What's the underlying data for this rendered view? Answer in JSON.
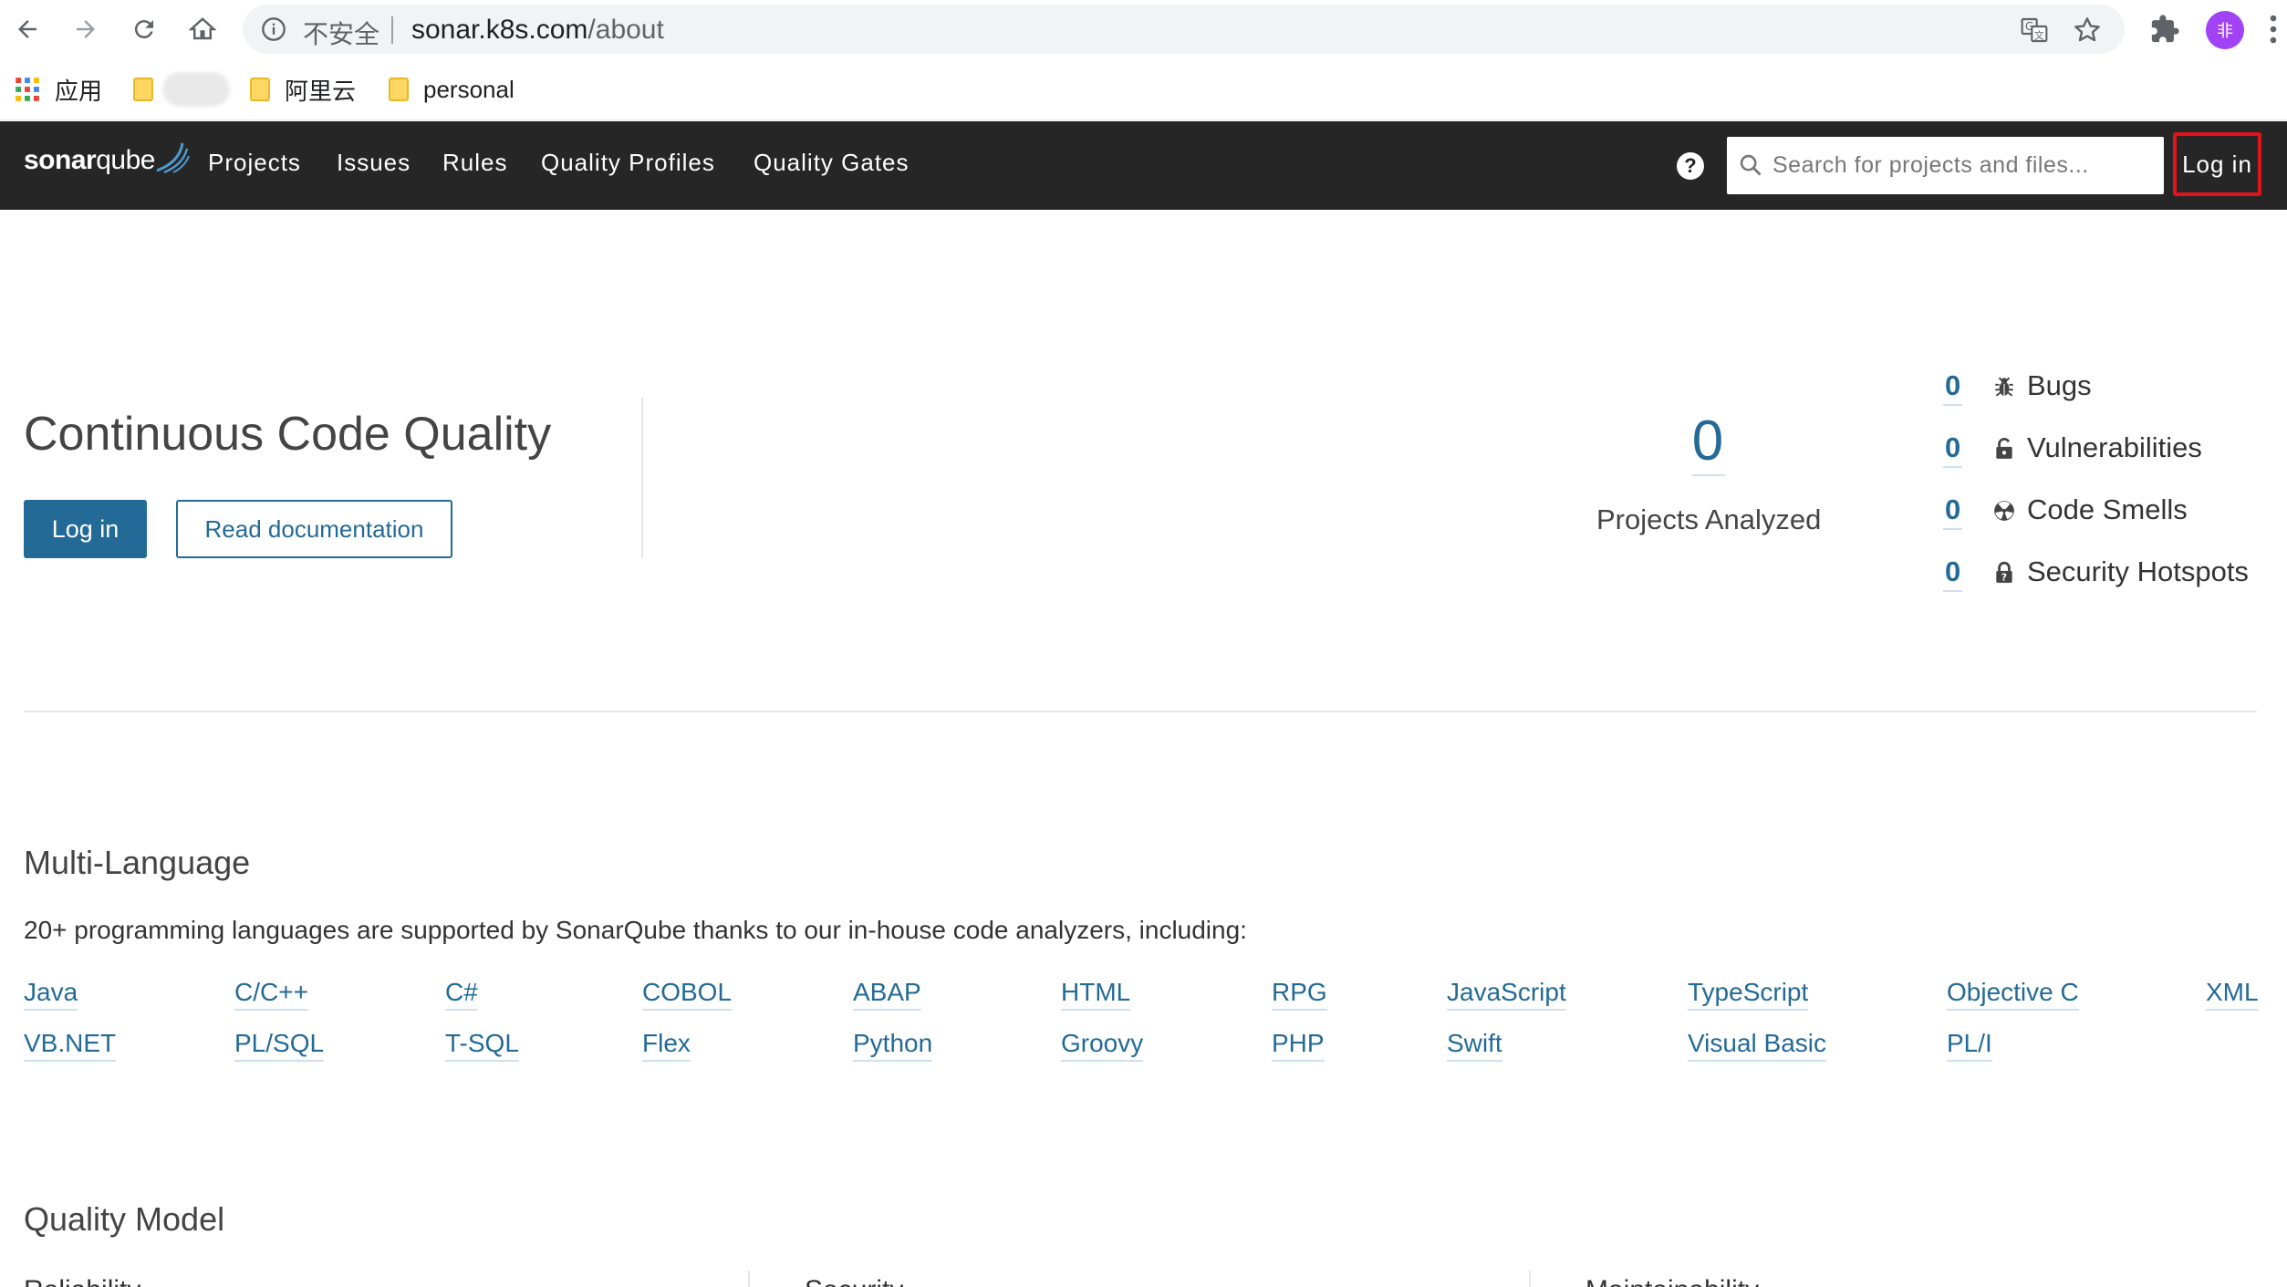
{
  "browser": {
    "insecure_label": "不安全",
    "url_host": "sonar.k8s.com",
    "url_path": "/about",
    "profile_initial": "非",
    "bookmarks": [
      {
        "label": "应用",
        "icon": "apps-grid-icon"
      },
      {
        "label": "",
        "icon": "folder-icon"
      },
      {
        "label": "阿里云",
        "icon": "folder-icon"
      },
      {
        "label": "personal",
        "icon": "folder-icon"
      }
    ]
  },
  "sonar_nav": {
    "logo_regular": "sonar",
    "logo_bold": "qube",
    "menu": [
      "Projects",
      "Issues",
      "Rules",
      "Quality Profiles",
      "Quality Gates"
    ],
    "search_placeholder": "Search for projects and files...",
    "login_label": "Log in",
    "colors": {
      "navbar": "#262626",
      "highlight_border": "#e0141a"
    }
  },
  "hero": {
    "title": "Continuous Code Quality",
    "login_button": "Log in",
    "docs_button": "Read documentation",
    "projects_count": "0",
    "projects_label": "Projects Analyzed",
    "metrics": [
      {
        "value": "0",
        "label": "Bugs",
        "icon": "bug-icon"
      },
      {
        "value": "0",
        "label": "Vulnerabilities",
        "icon": "lock-icon"
      },
      {
        "value": "0",
        "label": "Code Smells",
        "icon": "code-smell-icon"
      },
      {
        "value": "0",
        "label": "Security Hotspots",
        "icon": "security-hotspot-icon"
      }
    ],
    "accent": "#236a97"
  },
  "multi_language": {
    "title": "Multi-Language",
    "description": "20+ programming languages are supported by SonarQube thanks to our in-house code analyzers, including:",
    "row1": [
      "Java",
      "C/C++",
      "C#",
      "COBOL",
      "ABAP",
      "HTML",
      "RPG",
      "JavaScript",
      "TypeScript",
      "Objective C",
      "XML"
    ],
    "row2": [
      "VB.NET",
      "PL/SQL",
      "T-SQL",
      "Flex",
      "Python",
      "Groovy",
      "PHP",
      "Swift",
      "Visual Basic",
      "PL/I"
    ]
  },
  "quality_model": {
    "title": "Quality Model",
    "columns": [
      "Reliability",
      "Security",
      "Maintainability"
    ]
  }
}
